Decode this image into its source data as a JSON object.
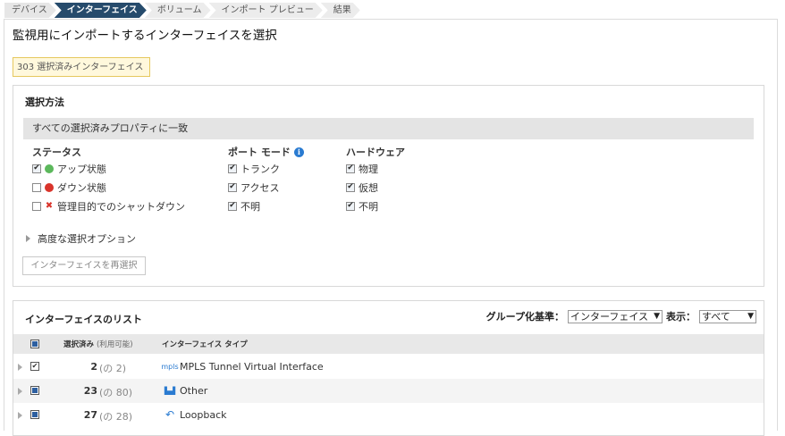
{
  "wizard": {
    "steps": [
      "デバイス",
      "インターフェイス",
      "ボリューム",
      "インポート プレビュー",
      "結果"
    ]
  },
  "page_title": "監視用にインポートするインターフェイスを選択",
  "selected_count": "303 選択済みインターフェイス",
  "selection": {
    "title": "選択方法",
    "match_label": "すべての選択済みプロパティに一致",
    "status": {
      "heading": "ステータス",
      "options": [
        {
          "label": "アップ状態",
          "checked": true,
          "icon": "green-dot-icon",
          "color": "#5cb85c"
        },
        {
          "label": "ダウン状態",
          "checked": false,
          "icon": "red-dot-icon",
          "color": "#d9342b"
        },
        {
          "label": "管理目的でのシャットダウン",
          "checked": false,
          "icon": "x-icon"
        }
      ]
    },
    "port_mode": {
      "heading": "ポート モード",
      "info_icon": "i",
      "options": [
        {
          "label": "トランク",
          "checked": true
        },
        {
          "label": "アクセス",
          "checked": true
        },
        {
          "label": "不明",
          "checked": true
        }
      ]
    },
    "hardware": {
      "heading": "ハードウェア",
      "options": [
        {
          "label": "物理",
          "checked": true
        },
        {
          "label": "仮想",
          "checked": true
        },
        {
          "label": "不明",
          "checked": true
        }
      ]
    },
    "advanced_label": "高度な選択オプション",
    "reselect_label": "インターフェイスを再選択"
  },
  "list": {
    "title": "インターフェイスのリスト",
    "group_by_label": "グループ化基準：",
    "group_by_value": "インターフェイス",
    "show_label": "表示：",
    "show_value": "すべて",
    "columns": {
      "selected": "選択済み",
      "available": "(利用可能)",
      "type": "インターフェイス タイプ"
    },
    "rows": [
      {
        "count": "2",
        "available": "(の 2)",
        "icon": "mpls-icon",
        "icon_text": "mpls",
        "type": "MPLS Tunnel Virtual Interface",
        "check": "checked"
      },
      {
        "count": "23",
        "available": "(の 80)",
        "icon": "other-icon",
        "icon_text": "▙▟",
        "type": "Other",
        "check": "partial"
      },
      {
        "count": "27",
        "available": "(の 28)",
        "icon": "loopback-icon",
        "icon_text": "↶",
        "type": "Loopback",
        "check": "partial"
      }
    ]
  }
}
